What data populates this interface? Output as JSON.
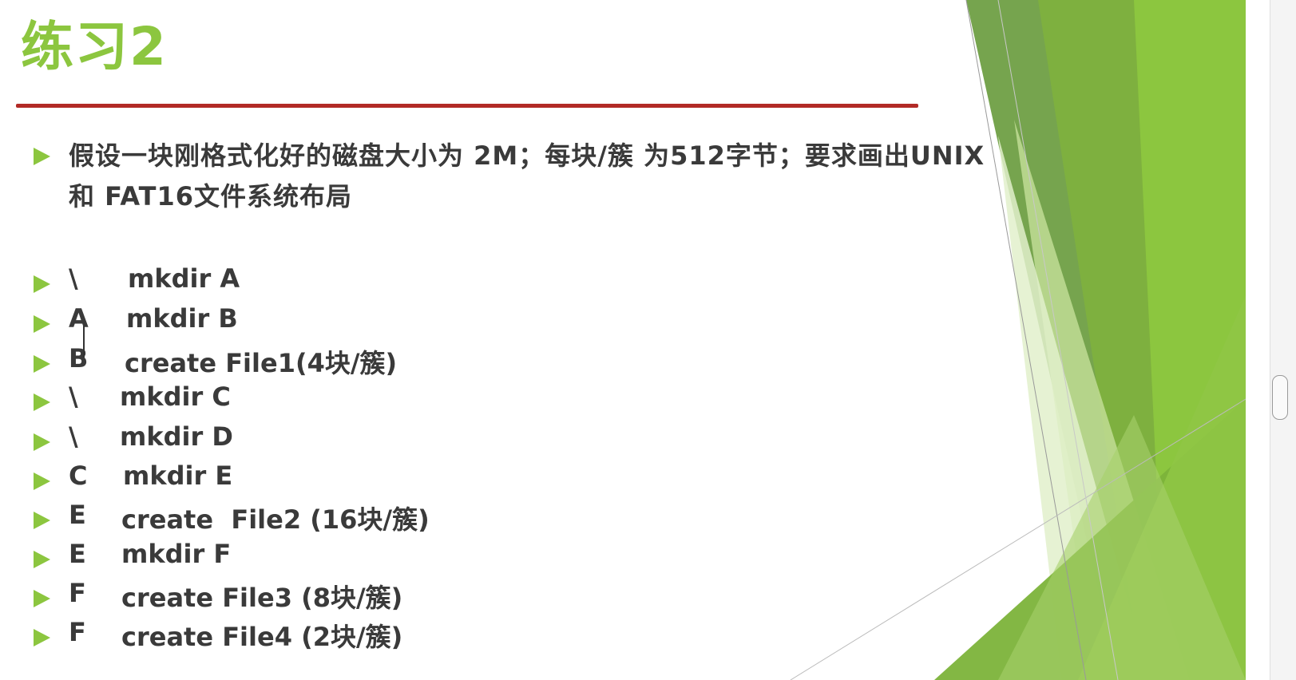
{
  "slide": {
    "title": "练习2",
    "paragraph": "假设一块刚格式化好的磁盘大小为 2M；每块/簇 为512字节；要求画出UNIX 和 FAT16文件系统布局",
    "commands": [
      {
        "dir": "\\",
        "op": "mkdir A"
      },
      {
        "dir": "A",
        "op": "mkdir B"
      },
      {
        "dir": "B",
        "op": "create File1(4块/簇)"
      },
      {
        "dir": "\\",
        "op": "mkdir C"
      },
      {
        "dir": "\\",
        "op": "mkdir D"
      },
      {
        "dir": "C",
        "op": "mkdir E"
      },
      {
        "dir": "E",
        "op": "create  File2 (16块/簇)"
      },
      {
        "dir": "E",
        "op": "mkdir F"
      },
      {
        "dir": "F",
        "op": "create File3 (8块/簇)"
      },
      {
        "dir": "F",
        "op": "create File4 (2块/簇)"
      }
    ]
  },
  "colors": {
    "accent": "#8cc63f",
    "rule": "#b22a26",
    "text": "#3a3a3a",
    "deco_dark": "#5f9a3a",
    "deco_light": "#d5e8b5"
  }
}
